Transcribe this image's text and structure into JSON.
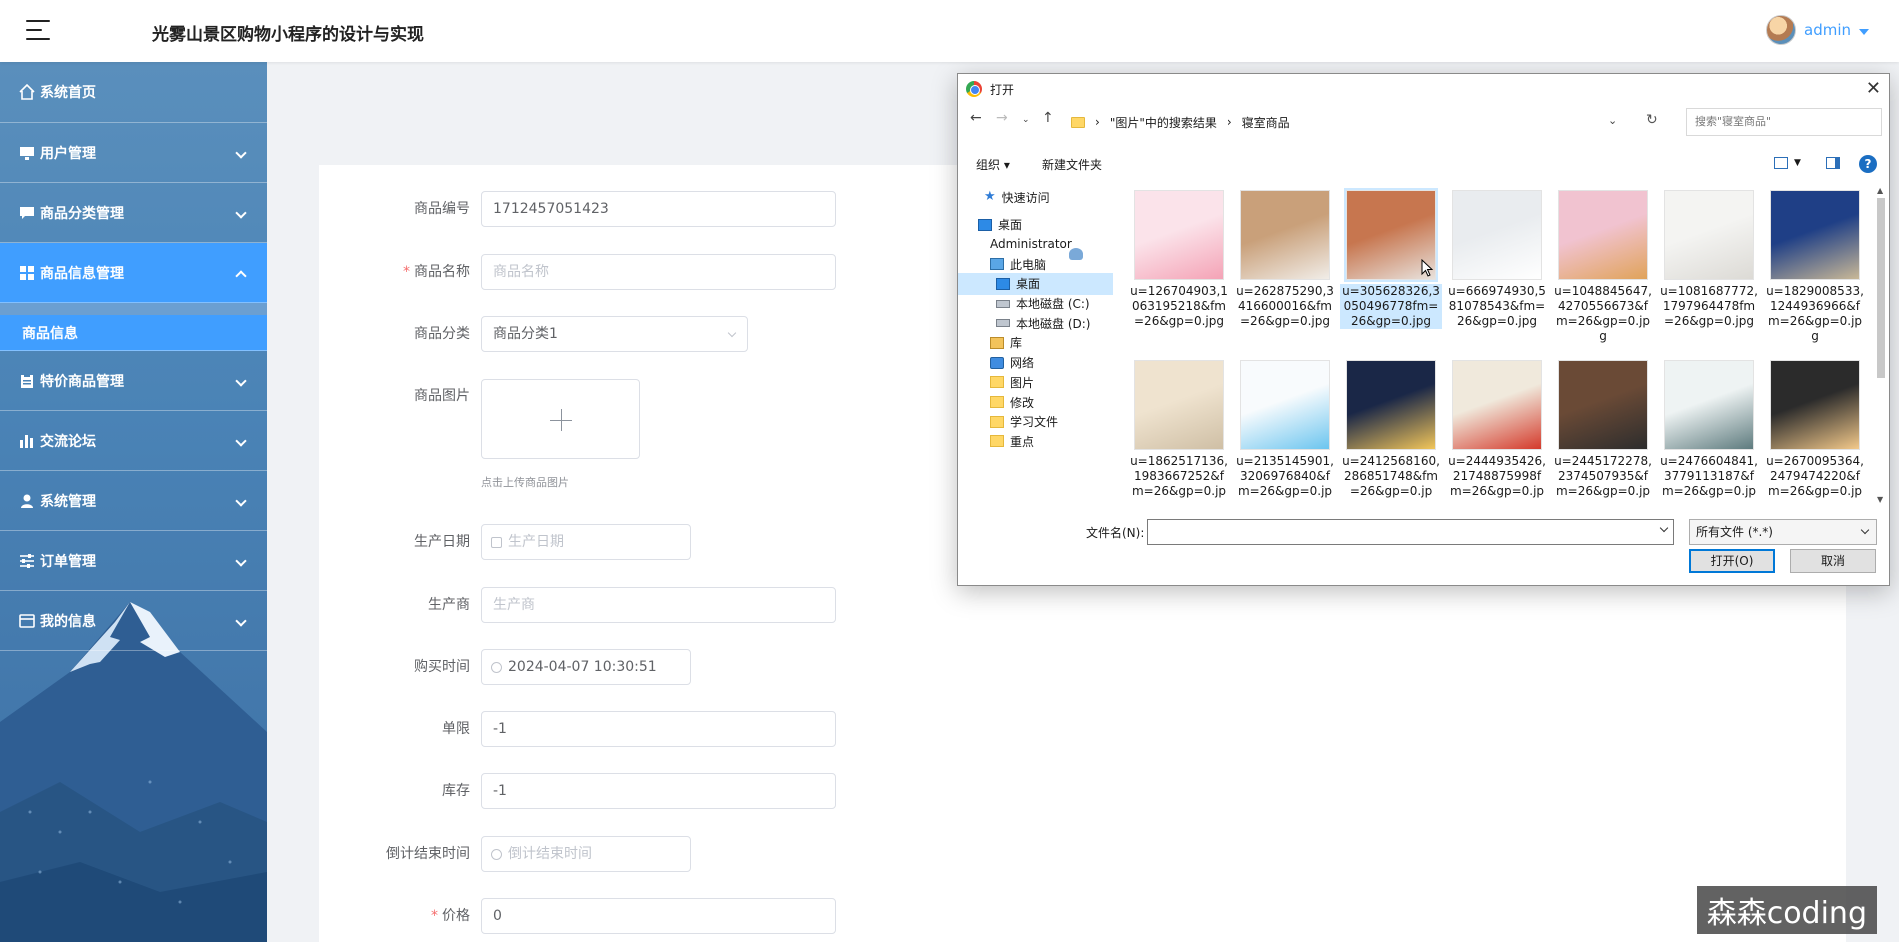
{
  "header": {
    "app_title": "光雾山景区购物小程序的设计与实现",
    "username": "admin"
  },
  "sidebar": {
    "items": [
      {
        "label": "系统首页",
        "icon": "home-icon",
        "expandable": false
      },
      {
        "label": "用户管理",
        "icon": "monitor-icon",
        "expandable": true
      },
      {
        "label": "商品分类管理",
        "icon": "chat-icon",
        "expandable": true
      },
      {
        "label": "商品信息管理",
        "icon": "grid-icon",
        "expandable": true,
        "active": true
      },
      {
        "label": "特价商品管理",
        "icon": "clipboard-icon",
        "expandable": true
      },
      {
        "label": "交流论坛",
        "icon": "bar-chart-icon",
        "expandable": true
      },
      {
        "label": "系统管理",
        "icon": "user-icon",
        "expandable": true
      },
      {
        "label": "订单管理",
        "icon": "sliders-icon",
        "expandable": true
      },
      {
        "label": "我的信息",
        "icon": "id-card-icon",
        "expandable": true
      }
    ],
    "subitem": "商品信息"
  },
  "form": {
    "code": {
      "label": "商品编号",
      "value": "1712457051423"
    },
    "name": {
      "label": "商品名称",
      "placeholder": "商品名称",
      "required": true
    },
    "category": {
      "label": "商品分类",
      "value": "商品分类1"
    },
    "image": {
      "label": "商品图片",
      "hint": "点击上传商品图片"
    },
    "prod_date": {
      "label": "生产日期",
      "placeholder": "生产日期"
    },
    "maker": {
      "label": "生产商",
      "placeholder": "生产商"
    },
    "buy_time": {
      "label": "购买时间",
      "value": "2024-04-07 10:30:51"
    },
    "limit": {
      "label": "单限",
      "value": "-1"
    },
    "stock": {
      "label": "库存",
      "value": "-1"
    },
    "countdown": {
      "label": "倒计结束时间",
      "placeholder": "倒计结束时间"
    },
    "price": {
      "label": "价格",
      "value": "0",
      "required": true
    }
  },
  "dialog": {
    "title": "打开",
    "path": [
      "\"图片\"中的搜索结果",
      "寝室商品"
    ],
    "search_placeholder": "搜索\"寝室商品\"",
    "toolbar": {
      "organize": "组织 ▾",
      "new_folder": "新建文件夹"
    },
    "nav": [
      {
        "label": "快速访问",
        "icon": "star"
      },
      {
        "label": "桌面",
        "icon": "desk"
      },
      {
        "label": "Administrator",
        "icon": "user"
      },
      {
        "label": "此电脑",
        "icon": "pc"
      },
      {
        "label": "桌面",
        "icon": "desk",
        "selected": true
      },
      {
        "label": "本地磁盘 (C:)",
        "icon": "drive"
      },
      {
        "label": "本地磁盘 (D:)",
        "icon": "drive"
      },
      {
        "label": "库",
        "icon": "lib"
      },
      {
        "label": "网络",
        "icon": "net"
      },
      {
        "label": "图片",
        "icon": "folder"
      },
      {
        "label": "修改",
        "icon": "folder"
      },
      {
        "label": "学习文件",
        "icon": "folder"
      },
      {
        "label": "重点",
        "icon": "folder"
      }
    ],
    "files": [
      {
        "name": "u=126704903,1063195218&fm=26&gp=0.jpg",
        "colors": [
          "#fbe3ea",
          "#f4a3b6"
        ]
      },
      {
        "name": "u=262875290,3416600016&fm=26&gp=0.jpg",
        "colors": [
          "#c9a07a",
          "#f1ede8"
        ]
      },
      {
        "name": "u=305628326,3050496778fm=26&gp=0.jpg",
        "colors": [
          "#c7764f",
          "#e8e2dd"
        ],
        "selected": true
      },
      {
        "name": "u=666974930,581078543&fm=26&gp=0.jpg",
        "colors": [
          "#e9ecef",
          "#ffffff"
        ]
      },
      {
        "name": "u=1048845647,4270556673&fm=26&gp=0.jpg",
        "colors": [
          "#f1c3d0",
          "#e0a35a"
        ]
      },
      {
        "name": "u=1081687772,1797964478fm=26&gp=0.jpg",
        "colors": [
          "#f4f4f2",
          "#dcdad5"
        ]
      },
      {
        "name": "u=1829008533,1244936966&fm=26&gp=0.jpg",
        "colors": [
          "#1f3f86",
          "#c9b897"
        ]
      },
      {
        "name": "u=1862517136,1983667252&fm=26&gp=0.jp",
        "colors": [
          "#efe3cf",
          "#cfbfa5"
        ]
      },
      {
        "name": "u=2135145901,3206976840&fm=26&gp=0.jp",
        "colors": [
          "#f8fbfd",
          "#6cc5ef"
        ]
      },
      {
        "name": "u=2412568160,286851748&fm=26&gp=0.jp",
        "colors": [
          "#1a2747",
          "#f2c65a"
        ]
      },
      {
        "name": "u=2444935426,21748875998fm=26&gp=0.jp",
        "colors": [
          "#f0e9dc",
          "#d43a2b"
        ]
      },
      {
        "name": "u=2445172278,2374507935&fm=26&gp=0.jp",
        "colors": [
          "#6a4a36",
          "#2d2d2d"
        ]
      },
      {
        "name": "u=2476604841,3779113187&fm=26&gp=0.jp",
        "colors": [
          "#eef3f3",
          "#5e7b7e"
        ]
      },
      {
        "name": "u=2670095364,2479474220&fm=26&gp=0.jp",
        "colors": [
          "#2b2b2b",
          "#f3c98a"
        ]
      }
    ],
    "filename_label": "文件名(N):",
    "filetype": "所有文件 (*.*)",
    "open_button": "打开(O)",
    "cancel_button": "取消"
  },
  "watermark": "森森coding",
  "colors": {
    "accent": "#409eff",
    "sidebar": "#4a83b6"
  }
}
